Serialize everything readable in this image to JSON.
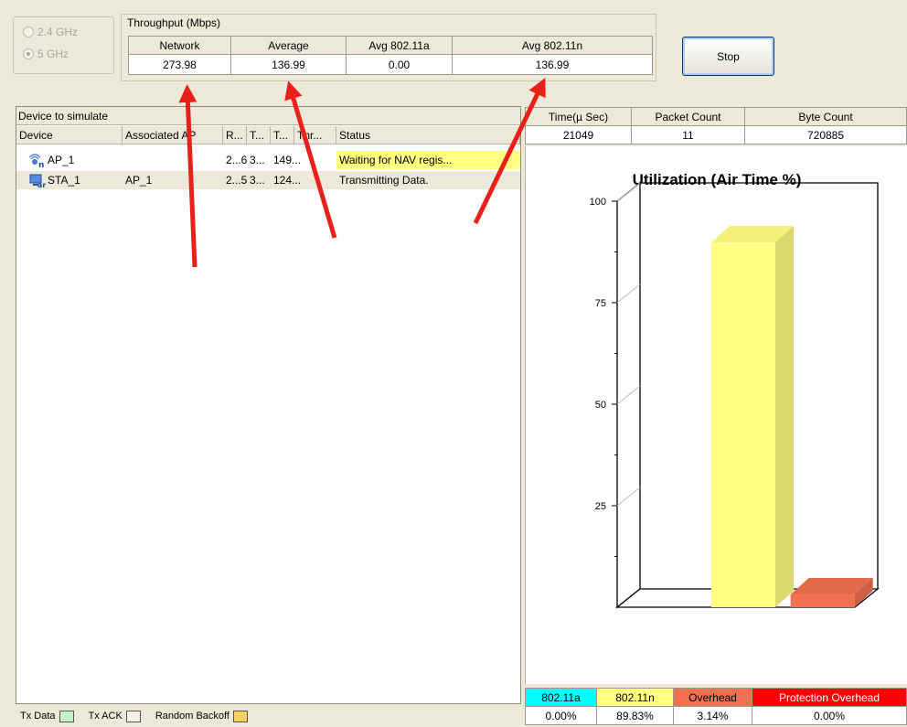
{
  "band": {
    "opt1": "2.4 GHz",
    "opt2": "5 GHz",
    "selected": "5 GHz"
  },
  "throughput": {
    "title": "Throughput (Mbps)",
    "headers": [
      "Network",
      "Average",
      "Avg 802.11a",
      "Avg 802.11n"
    ],
    "values": [
      "273.98",
      "136.99",
      "0.00",
      "136.99"
    ]
  },
  "stop_label": "Stop",
  "devices": {
    "caption": "Device to simulate",
    "headers": [
      "Device",
      "Associated AP",
      "R...",
      "T...",
      "T...",
      "Thr...",
      "Status"
    ],
    "rows": [
      {
        "device": "AP_1",
        "ap": "",
        "r": "2...6",
        "t1": "3...",
        "t2": "149...",
        "status": "Waiting for NAV regis..."
      },
      {
        "device": "STA_1",
        "ap": "AP_1",
        "r": "2...5",
        "t1": "3...",
        "t2": "124...",
        "status": "Transmitting Data."
      }
    ]
  },
  "legend": {
    "tx_data": "Tx Data",
    "tx_ack": "Tx ACK",
    "random_backoff": "Random Backoff"
  },
  "stats": {
    "headers": [
      "Time(µ Sec)",
      "Packet Count",
      "Byte Count"
    ],
    "values": [
      "21049",
      "11",
      "720885"
    ]
  },
  "utilization": {
    "labels": [
      "802.11a",
      "802.11n",
      "Overhead",
      "Protection Overhead"
    ],
    "values": [
      "0.00%",
      "89.83%",
      "3.14%",
      "0.00%"
    ],
    "colors": [
      "#00ffff",
      "#ffff80",
      "#f07050",
      "#ff0000"
    ]
  },
  "chart_data": {
    "type": "bar",
    "title": "Utilization (Air Time %)",
    "categories": [
      "802.11a",
      "802.11n",
      "Overhead"
    ],
    "values": [
      0,
      89.83,
      3.14
    ],
    "colors": [
      "#00ffff",
      "#ffff80",
      "#f07050"
    ],
    "ylim": [
      0,
      100
    ],
    "yticks": [
      25,
      50,
      75,
      100
    ],
    "grid": false
  }
}
